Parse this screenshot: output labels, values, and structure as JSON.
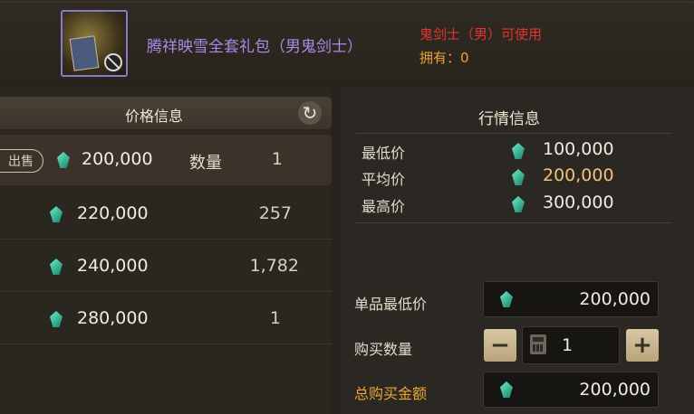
{
  "item": {
    "name": "腾祥映雪全套礼包（男鬼剑士）",
    "class_requirement": "鬼剑士（男）可使用",
    "owned": "拥有：0"
  },
  "price_panel": {
    "title": "价格信息",
    "sell_label": "出售",
    "qty_label": "数量",
    "rows": [
      {
        "price": "200,000",
        "qty": "1"
      },
      {
        "price": "220,000",
        "qty": "257"
      },
      {
        "price": "240,000",
        "qty": "1,782"
      },
      {
        "price": "280,000",
        "qty": "1"
      }
    ]
  },
  "market_panel": {
    "title": "行情信息",
    "min_label": "最低价",
    "min_value": "100,000",
    "avg_label": "平均价",
    "avg_value": "200,000",
    "max_label": "最高价",
    "max_value": "300,000"
  },
  "purchase": {
    "unit_min_label": "单品最低价",
    "unit_min_value": "200,000",
    "qty_label": "购买数量",
    "qty_value": "1",
    "minus": "−",
    "plus": "+",
    "total_label": "总购买金额",
    "total_value": "200,000"
  },
  "colors": {
    "rarity_purple": "#a98ae6",
    "requirement_red": "#e2362c",
    "gold_text": "#e8a63a",
    "gem_teal": "#3fd1b0"
  },
  "icons": [
    "item-icon",
    "ban-icon",
    "refresh-icon",
    "gem-icon",
    "calculator-icon"
  ]
}
